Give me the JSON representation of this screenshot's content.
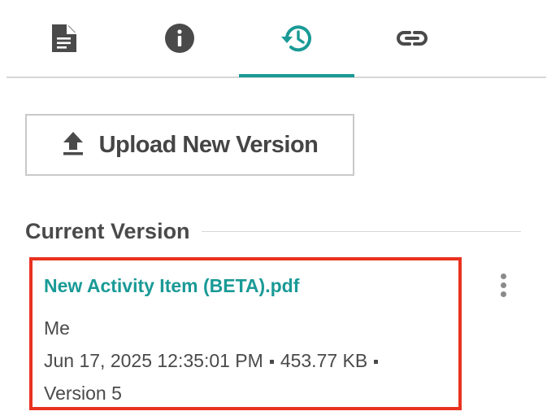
{
  "tabs": [
    {
      "icon": "document-icon",
      "active": false
    },
    {
      "icon": "info-icon",
      "active": false
    },
    {
      "icon": "history-icon",
      "active": true
    },
    {
      "icon": "link-icon",
      "active": false
    }
  ],
  "upload": {
    "label": "Upload New Version",
    "icon": "upload-icon"
  },
  "current_version": {
    "heading": "Current Version",
    "file_name": "New Activity Item (BETA).pdf",
    "owner": "Me",
    "date": "Jun 17, 2025 12:35:01 PM",
    "size": "453.77 KB",
    "version": "Version 5"
  },
  "colors": {
    "accent": "#1a9a96",
    "highlight_border": "#e8321f",
    "text": "#4a4a4a",
    "icon": "#4a4a4a"
  }
}
